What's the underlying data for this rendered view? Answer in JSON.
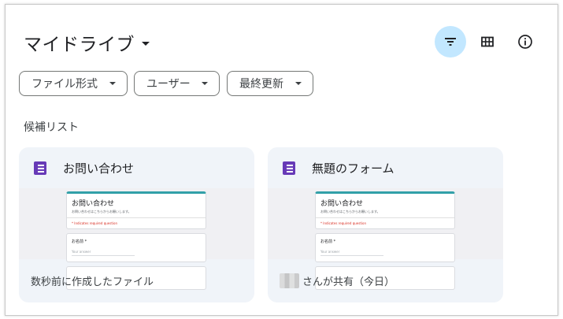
{
  "header": {
    "title": "マイドライブ"
  },
  "toolbar": {
    "filter_icon": "filter-icon",
    "grid_icon": "grid-view-icon",
    "info_icon": "info-icon"
  },
  "filters": [
    {
      "label": "ファイル形式"
    },
    {
      "label": "ユーザー"
    },
    {
      "label": "最終更新"
    }
  ],
  "suggested": {
    "label": "候補リスト",
    "cards": [
      {
        "title": "お問い合わせ",
        "icon": "google-forms-icon",
        "preview": {
          "form_title": "お問い合わせ",
          "form_desc": "お問い合わせはこちらからお願いします。",
          "required_note": "* Indicates required question",
          "question": "お名前 *",
          "answer_hint": "Your answer"
        },
        "footer": "数秒前に作成したファイル"
      },
      {
        "title": "無題のフォーム",
        "icon": "google-forms-icon",
        "preview": {
          "form_title": "お問い合わせ",
          "form_desc": "お問い合わせはこちらからお願いします。",
          "required_note": "* Indicates required question",
          "question": "お名前 *",
          "answer_hint": "Your answer"
        },
        "footer": "さんが共有（今日）"
      }
    ]
  },
  "colors": {
    "accent_active": "#c2e7ff",
    "forms_purple": "#673ab7",
    "card_bg": "#f0f4f9"
  }
}
